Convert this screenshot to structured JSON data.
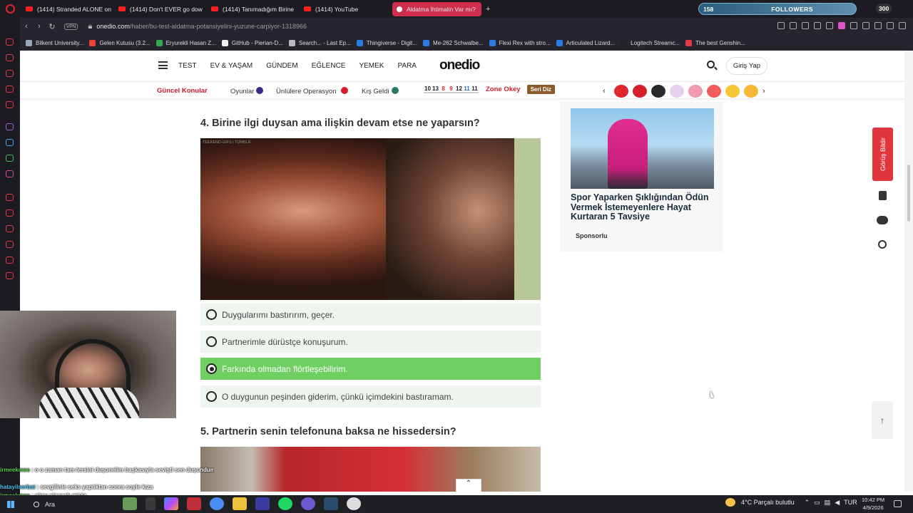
{
  "browser": {
    "tabs": [
      {
        "label": "(1414) Stranded ALONE on"
      },
      {
        "label": "(1414) Don't EVER go dow"
      },
      {
        "label": "(1414) Tanımadığım Birine"
      },
      {
        "label": "(1414) YouTube"
      },
      {
        "label": "Aldatma İhtimalin Var mı?"
      }
    ],
    "new_tab": "+",
    "vpn": "VPN",
    "url_host": "onedio.com",
    "url_path": "/haber/bu-test-aldatma-potansiyelini-yuzune-carpiyor-1318966",
    "bookmarks": [
      {
        "label": "Bilkent University...",
        "color": "#9aa7b5"
      },
      {
        "label": "Gelen Kutusu (3.2...",
        "color": "#ea4335"
      },
      {
        "label": "Eryurekli Hasan Z...",
        "color": "#34a853"
      },
      {
        "label": "GitHub - Pierian-D...",
        "color": "#f0f0f0"
      },
      {
        "label": "Search... - Last Ep...",
        "color": "#bbbbbb"
      },
      {
        "label": "Thingiverse - Digit...",
        "color": "#2c7be5"
      },
      {
        "label": "Me-262 Schwalbe...",
        "color": "#2c7be5"
      },
      {
        "label": "Flexi Rex with stro...",
        "color": "#2c7be5"
      },
      {
        "label": "Articulated Lizard...",
        "color": "#2c7be5"
      },
      {
        "label": "Logitech Streamc...",
        "color": "#222222"
      },
      {
        "label": "The best Genshin...",
        "color": "#e23a4b"
      }
    ]
  },
  "overlay": {
    "followers_count": "158",
    "followers_label": "FOLLOWERS",
    "followers_goal": "300"
  },
  "site": {
    "menu": [
      "TEST",
      "EV & YAŞAM",
      "GÜNDEM",
      "EĞLENCE",
      "YEMEK",
      "PARA"
    ],
    "logo": "onedio",
    "login": "Giriş Yap",
    "guncel": "Güncel Konular",
    "topics": [
      {
        "label": "Oyunlar",
        "dot": "#3a2a8a"
      },
      {
        "label": "Ünlülere Operasyon",
        "dot": "#d41b2a"
      },
      {
        "label": "Kış Geldi",
        "dot": "#2a7a6a"
      }
    ],
    "okey_tiles": [
      {
        "n": "10",
        "c": "#1a1a1a"
      },
      {
        "n": "13",
        "c": "#1a1a1a"
      },
      {
        "n": "8",
        "c": "#d22"
      },
      {
        "n": "9",
        "c": "#d22"
      },
      {
        "n": "12",
        "c": "#1a1a1a"
      },
      {
        "n": "11",
        "c": "#1a6ad2"
      },
      {
        "n": "11",
        "c": "#1a1a1a"
      }
    ],
    "zone_okey": "Zone Okey",
    "seri_diz": "Seri Diz",
    "prev_arrow": "‹",
    "next_arrow": "›",
    "emoji_colors": [
      "#e0262c",
      "#d6202a",
      "#2a2a2a",
      "#e6d0f0",
      "#f09ab0",
      "#f25c5c",
      "#f5c636",
      "#f5b735"
    ],
    "q4": "4. Birine ilgi duysan ama ilişkin devam etse ne yaparsın?",
    "gif_watermark": "TEEKEND-GIFS | TUMBLR",
    "options": [
      "Duygularımı bastırırım, geçer.",
      "Partnerimle dürüstçe konuşurum.",
      "Farkında olmadan flörtleşebilirim.",
      "O duygunun peşinden giderim, çünkü içimdekini bastıramam."
    ],
    "selected_option": 2,
    "q5": "5. Partnerin senin telefonuna baksa ne hissedersin?",
    "ad_title": "Spor Yaparken Şıklığından Ödün Vermek İstemeyenlere Hayat Kurtaran 5 Tavsiye",
    "ad_sponsor": "Sponsorlu",
    "feedback": "Görüş Bildir",
    "to_top": "↑",
    "collapse": "⌃"
  },
  "chat": [
    {
      "user": "irmeekmee",
      "msg": ": o o zaman tam tersini duşunelim başkasıyla sevişti sen duşundum dedi"
    },
    {
      "user": "hatayilserbat",
      "msg": ": sevgilinle seks yaptıktan sonra soyle kıza"
    },
    {
      "user": "irmeekmee",
      "msg": ": okey olaacak miyiz"
    }
  ],
  "taskbar": {
    "search": "Ara",
    "weather": "4°C  Parçalı bulutlu",
    "lang": "TUR",
    "time": "10:42 PM",
    "date": "4/9/2026"
  }
}
